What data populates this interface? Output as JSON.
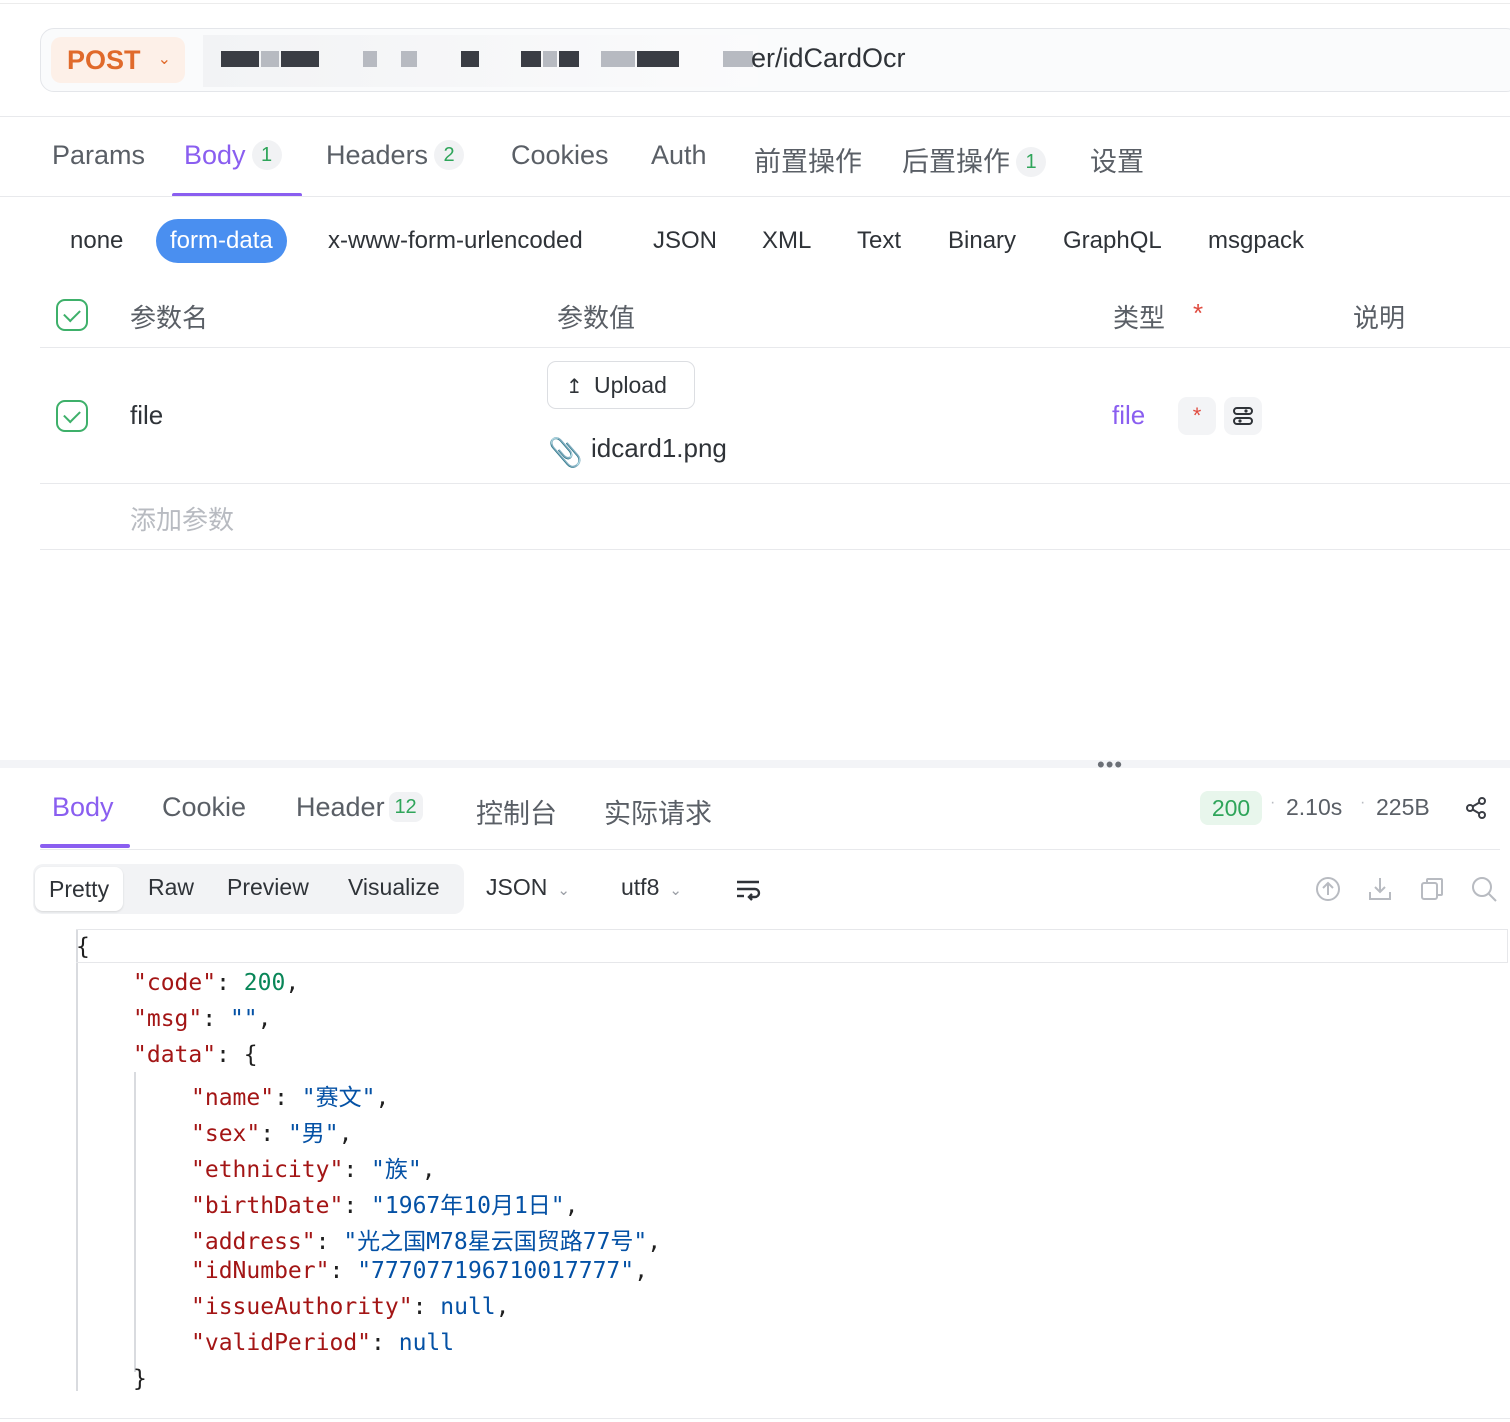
{
  "request": {
    "method": "POST",
    "url_visible": "er/idCardOcr"
  },
  "request_tabs": [
    {
      "label": "Params"
    },
    {
      "label": "Body",
      "badge": "1"
    },
    {
      "label": "Headers",
      "badge": "2"
    },
    {
      "label": "Cookies"
    },
    {
      "label": "Auth"
    },
    {
      "label": "前置操作"
    },
    {
      "label": "后置操作",
      "badge": "1"
    },
    {
      "label": "设置"
    }
  ],
  "body_types": [
    "none",
    "form-data",
    "x-www-form-urlencoded",
    "JSON",
    "XML",
    "Text",
    "Binary",
    "GraphQL",
    "msgpack"
  ],
  "params_table": {
    "headers": {
      "name": "参数名",
      "value": "参数值",
      "type": "类型",
      "required_mark": "*",
      "desc": "说明"
    },
    "rows": [
      {
        "name": "file",
        "upload_label": "Upload",
        "file_name": "idcard1.png",
        "type": "file",
        "required_mark": "*"
      }
    ],
    "add_placeholder": "添加参数"
  },
  "response_tabs": [
    {
      "label": "Body"
    },
    {
      "label": "Cookie"
    },
    {
      "label": "Header",
      "badge": "12"
    },
    {
      "label": "控制台"
    },
    {
      "label": "实际请求"
    }
  ],
  "response_meta": {
    "status": "200",
    "time": "2.10s",
    "size": "225B"
  },
  "view_modes": [
    "Pretty",
    "Raw",
    "Preview",
    "Visualize"
  ],
  "format_select": "JSON",
  "encoding_select": "utf8",
  "response_json": {
    "open": "{",
    "code_key": "\"code\"",
    "code_val": "200",
    "msg_key": "\"msg\"",
    "msg_val": "\"\"",
    "data_key": "\"data\"",
    "data_open": "{",
    "name_key": "\"name\"",
    "name_val": "\"赛文\"",
    "sex_key": "\"sex\"",
    "sex_val": "\"男\"",
    "ethnicity_key": "\"ethnicity\"",
    "ethnicity_val": "\"族\"",
    "birthDate_key": "\"birthDate\"",
    "birthDate_val": "\"1967年10月1日\"",
    "address_key": "\"address\"",
    "address_val": "\"光之国M78星云国贸路77号\"",
    "idNumber_key": "\"idNumber\"",
    "idNumber_val": "\"777077196710017777\"",
    "issueAuthority_key": "\"issueAuthority\"",
    "issueAuthority_val": "null",
    "validPeriod_key": "\"validPeriod\"",
    "validPeriod_val": "null",
    "data_close": "}"
  },
  "colors": {
    "accent": "#8a5ef0",
    "method": "#e06a2b",
    "status_ok": "#2fa55a",
    "pill": "#4a8ff0"
  }
}
